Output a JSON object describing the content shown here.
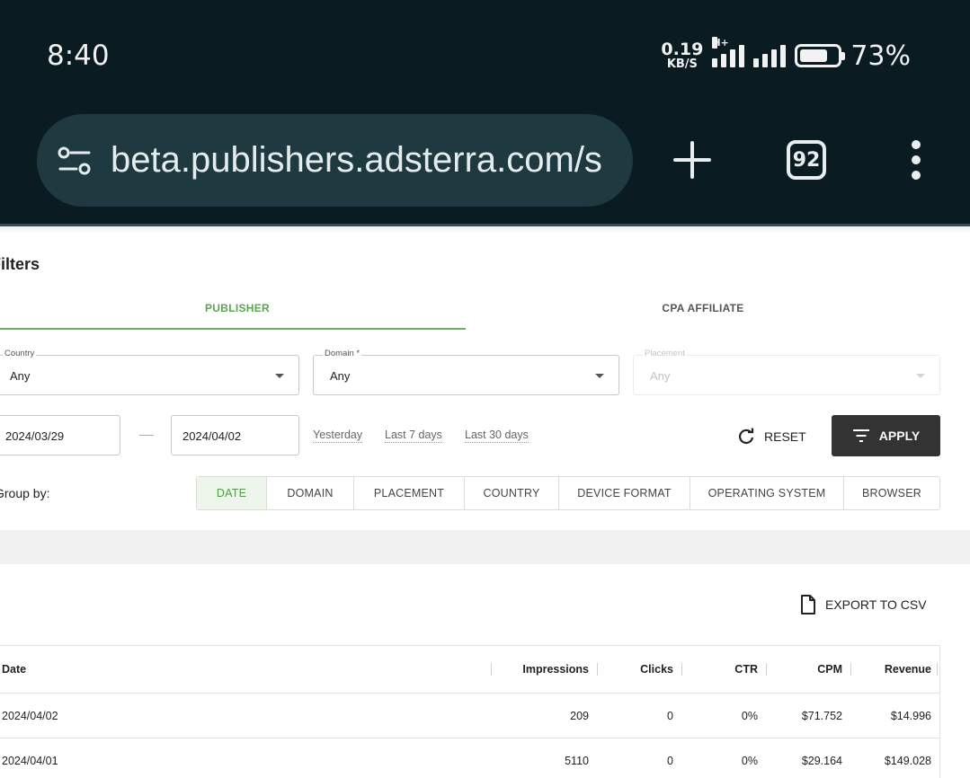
{
  "status_bar": {
    "time": "8:40",
    "net_speed_value": "0.19",
    "net_speed_unit": "KB/S",
    "network_type": "H+",
    "battery_level": 0.73,
    "battery_percent": "73%"
  },
  "browser": {
    "url": "beta.publishers.adsterra.com/s",
    "tab_count": "92"
  },
  "filters": {
    "title": "Filters",
    "tabs": [
      {
        "label": "PUBLISHER",
        "active": true
      },
      {
        "label": "CPA AFFILIATE",
        "active": false
      }
    ],
    "country": {
      "label": "Country",
      "value": "Any"
    },
    "domain": {
      "label": "Domain *",
      "value": "Any"
    },
    "placement": {
      "label": "Placement",
      "value": "Any",
      "disabled": true
    },
    "date_from": "2024/03/29",
    "date_to": "2024/04/02",
    "quick_ranges": [
      "Yesterday",
      "Last 7 days",
      "Last 30 days"
    ],
    "reset_label": "RESET",
    "apply_label": "APPLY",
    "group_by_label": "Group by:",
    "group_by_options": [
      {
        "label": "DATE",
        "active": true
      },
      {
        "label": "DOMAIN",
        "active": false
      },
      {
        "label": "PLACEMENT",
        "active": false
      },
      {
        "label": "COUNTRY",
        "active": false
      },
      {
        "label": "DEVICE FORMAT",
        "active": false
      },
      {
        "label": "OPERATING SYSTEM",
        "active": false
      },
      {
        "label": "BROWSER",
        "active": false
      }
    ]
  },
  "report": {
    "export_label": "EXPORT TO CSV",
    "columns": [
      "Date",
      "Impressions",
      "Clicks",
      "CTR",
      "CPM",
      "Revenue"
    ],
    "rows": [
      [
        "2024/04/02",
        "209",
        "0",
        "0%",
        "$71.752",
        "$14.996"
      ],
      [
        "2024/04/01",
        "5110",
        "0",
        "0%",
        "$29.164",
        "$149.028"
      ]
    ]
  },
  "colors": {
    "chrome_bg": "#0a1b22",
    "urlbar_bg": "#1e3a40",
    "accent_green": "#5aa64f",
    "apply_bg": "#333333"
  }
}
